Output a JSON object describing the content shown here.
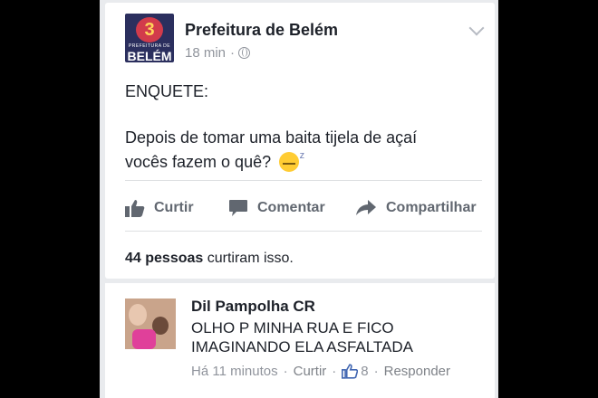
{
  "post": {
    "page_name": "Prefeitura de Belém",
    "time": "18 min",
    "dot": "·",
    "logo": {
      "subtitle": "PREFEITURA DE",
      "name": "BELÉM",
      "mark": "3"
    },
    "lines": [
      "ENQUETE:",
      "Depois de tomar uma baita tijela de açaí",
      "vocês fazem o quê?"
    ],
    "emoji": "sleeping-face"
  },
  "actions": {
    "like": "Curtir",
    "comment": "Comentar",
    "share": "Compartilhar"
  },
  "likes": {
    "count": "44 pessoas",
    "text": "curtiram isso."
  },
  "comment": {
    "author": "Dil Pampolha CR",
    "text": "OLHO P MINHA RUA E FICO IMAGINANDO ELA ASFALTADA",
    "time": "Há 11 minutos",
    "like_label": "Curtir",
    "like_count": "8",
    "reply_label": "Responder",
    "dot": "·"
  },
  "colors": {
    "text": "#1d2129",
    "muted": "#90949c",
    "action": "#616770",
    "background": "#e9ebee"
  }
}
